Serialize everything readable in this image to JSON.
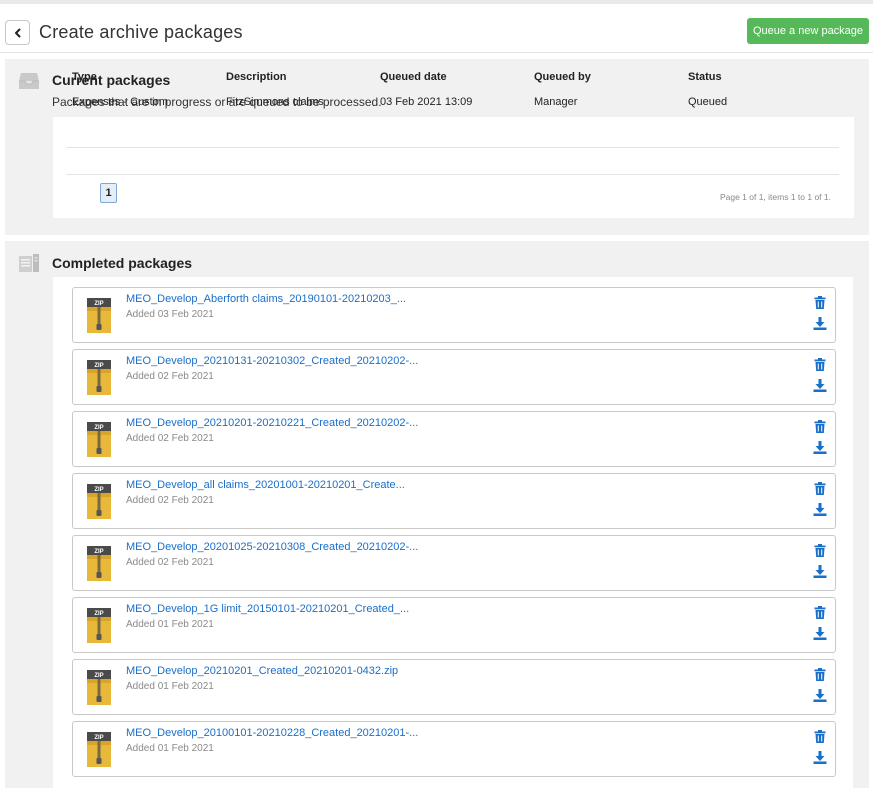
{
  "header": {
    "title": "Create archive packages",
    "queue_button": "Queue a new package"
  },
  "current": {
    "title": "Current packages",
    "subtitle": "Packages that are in progress or are queued to be processed.",
    "columns": [
      "Type",
      "Description",
      "Queued date",
      "Queued by",
      "Status"
    ],
    "rows": [
      [
        "Expenses - Custom",
        "FitzSimmons claims",
        "03 Feb 2021 13:09",
        "Manager",
        "Queued"
      ]
    ],
    "page": "1",
    "page_info": "Page 1 of 1, items 1 to 1 of 1."
  },
  "completed": {
    "title": "Completed packages",
    "items": [
      {
        "name": "MEO_Develop_Aberforth claims_20190101-20210203_...",
        "added": "Added 03 Feb 2021"
      },
      {
        "name": "MEO_Develop_20210131-20210302_Created_20210202-...",
        "added": "Added 02 Feb 2021"
      },
      {
        "name": "MEO_Develop_20210201-20210221_Created_20210202-...",
        "added": "Added 02 Feb 2021"
      },
      {
        "name": "MEO_Develop_all claims_20201001-20210201_Create...",
        "added": "Added 02 Feb 2021"
      },
      {
        "name": "MEO_Develop_20201025-20210308_Created_20210202-...",
        "added": "Added 02 Feb 2021"
      },
      {
        "name": "MEO_Develop_1G limit_20150101-20210201_Created_...",
        "added": "Added 01 Feb 2021"
      },
      {
        "name": "MEO_Develop_20210201_Created_20210201-0432.zip",
        "added": "Added 01 Feb 2021"
      },
      {
        "name": "MEO_Develop_20100101-20210228_Created_20210201-...",
        "added": "Added 01 Feb 2021"
      }
    ]
  },
  "icons": {
    "back": "chevron-left-icon",
    "inbox": "inbox-tray-icon",
    "archive": "archive-files-icon",
    "zip": "zip-file-icon",
    "trash": "trash-icon",
    "download": "download-icon"
  },
  "colors": {
    "accent_green": "#55b859",
    "link_blue": "#1a6fc9",
    "panel_grey": "#f1f1f1"
  }
}
